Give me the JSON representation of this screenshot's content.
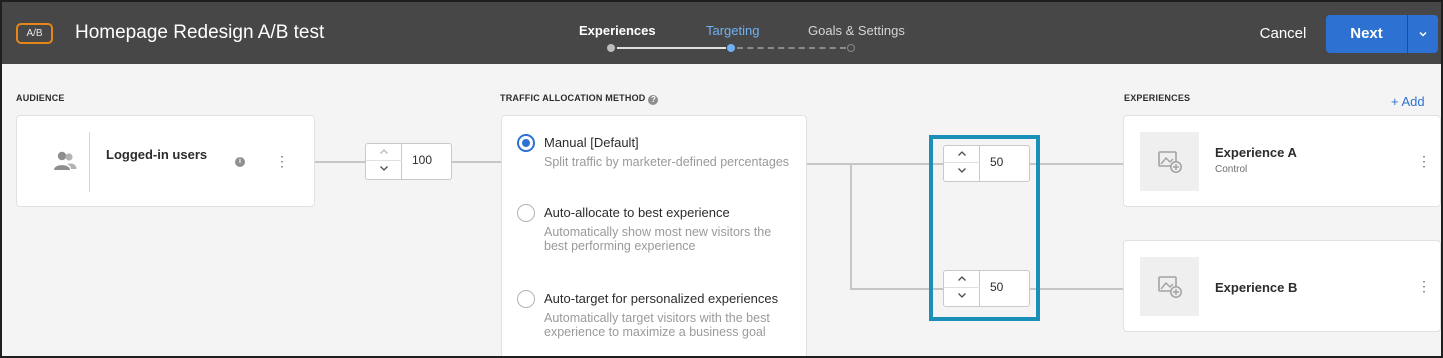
{
  "header": {
    "badge": "A/B",
    "title": "Homepage Redesign A/B test",
    "steps": [
      {
        "label": "Experiences",
        "state": "done"
      },
      {
        "label": "Targeting",
        "state": "active"
      },
      {
        "label": "Goals & Settings",
        "state": "todo"
      }
    ],
    "cancel_label": "Cancel",
    "next_label": "Next",
    "next_dropdown_icon": "chevron-down-icon"
  },
  "audience": {
    "section_label": "AUDIENCE",
    "name": "Logged-in users",
    "icon": "users-icon",
    "info_icon": "info-icon",
    "menu_icon": "more-vertical-icon",
    "allocation": "100"
  },
  "traffic": {
    "section_label": "TRAFFIC ALLOCATION METHOD",
    "help_icon": "help-icon",
    "options": [
      {
        "title": "Manual [Default]",
        "description": "Split traffic by marketer-defined percentages",
        "selected": true
      },
      {
        "title": "Auto-allocate to best experience",
        "description": "Automatically show most new visitors the best performing experience",
        "selected": false
      },
      {
        "title": "Auto-target for personalized experiences",
        "description": "Automatically target visitors with the best experience to maximize a business goal",
        "selected": false
      }
    ]
  },
  "splits": [
    "50",
    "50"
  ],
  "experiences": {
    "section_label": "EXPERIENCES",
    "add_label": "+ Add",
    "items": [
      {
        "name": "Experience A",
        "subtitle": "Control",
        "thumb_icon": "image-add-icon"
      },
      {
        "name": "Experience B",
        "subtitle": "",
        "thumb_icon": "image-add-icon"
      }
    ]
  },
  "colors": {
    "header_bg": "#474747",
    "accent": "#2d72d2",
    "badge_border": "#e68619",
    "highlight": "#1a8fb7"
  }
}
